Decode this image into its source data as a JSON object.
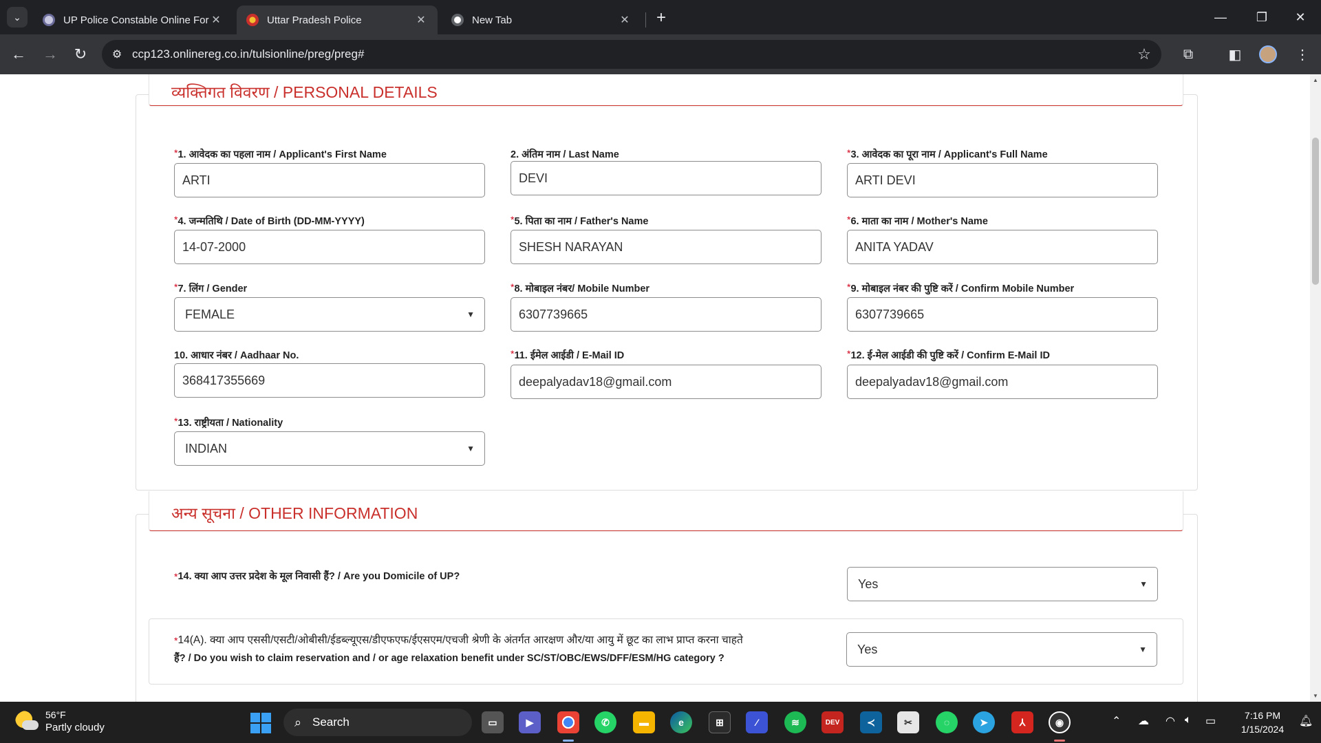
{
  "browser": {
    "tabs": [
      {
        "title": "UP Police Constable Online For",
        "active": false
      },
      {
        "title": "Uttar Pradesh Police",
        "active": true
      },
      {
        "title": "New Tab",
        "active": false
      }
    ],
    "url": "ccp123.onlinereg.co.in/tulsionline/preg/preg#"
  },
  "personal": {
    "heading": "व्यक्तिगत विवरण / PERSONAL DETAILS",
    "fields": [
      {
        "req": "*",
        "label": "1. आवेदक का पहला नाम / Applicant's First Name",
        "value": "ARTI"
      },
      {
        "req": "",
        "label": "2. अंतिम नाम / Last Name",
        "value": "DEVI"
      },
      {
        "req": "*",
        "label": "3. आवेदक का पूरा नाम / Applicant's Full Name",
        "value": "ARTI DEVI"
      },
      {
        "req": "*",
        "label": "4. जन्मतिथि / Date of Birth (DD-MM-YYYY)",
        "value": "14-07-2000"
      },
      {
        "req": "*",
        "label": "5. पिता का नाम / Father's Name",
        "value": "SHESH NARAYAN"
      },
      {
        "req": "*",
        "label": "6. माता का नाम / Mother's Name",
        "value": "ANITA YADAV"
      },
      {
        "req": "*",
        "label": "7. लिंग / Gender",
        "value": "FEMALE"
      },
      {
        "req": "*",
        "label": "8. मोबाइल नंबर/ Mobile Number",
        "value": "6307739665"
      },
      {
        "req": "*",
        "label": "9. मोबाइल नंबर की पुष्टि करें / Confirm Mobile Number",
        "value": "6307739665"
      },
      {
        "req": "",
        "label": "10. आधार नंबर / Aadhaar No.",
        "value": "368417355669"
      },
      {
        "req": "*",
        "label": "11. ईमेल आईडी / E-Mail ID",
        "value": "deepalyadav18@gmail.com"
      },
      {
        "req": "*",
        "label": "12. ई-मेल आईडी की पुष्टि करें / Confirm E-Mail ID",
        "value": "deepalyadav18@gmail.com"
      },
      {
        "req": "*",
        "label": "13. राष्ट्रीयता / Nationality",
        "value": "INDIAN"
      }
    ]
  },
  "other": {
    "heading": "अन्य सूचना / OTHER INFORMATION",
    "q14": {
      "req": "*",
      "label": "14. क्या आप उत्तर प्रदेश के मूल निवासी हैं? / Are you Domicile of UP?",
      "value": "Yes"
    },
    "q14a": {
      "req": "*",
      "label_line1": "14(A). क्या आप एससी/एसटी/ओबीसी/ईडब्ल्यूएस/डीएफएफ/ईएसएम/एचजी श्रेणी के अंतर्गत  आरक्षण और/या आयु में छूट का लाभ प्राप्त  करना चाहते",
      "label_line2": "हैं? / Do you wish to claim reservation and / or age relaxation benefit under SC/ST/OBC/EWS/DFF/ESM/HG category ?",
      "value": "Yes"
    }
  },
  "taskbar": {
    "weather_temp": "56°F",
    "weather_desc": "Partly cloudy",
    "search_label": "Search",
    "time": "7:16 PM",
    "date": "1/15/2024"
  },
  "colors": {
    "heading_red": "#c9302c",
    "required_red": "#d0021b",
    "chrome_dark": "#202124"
  }
}
